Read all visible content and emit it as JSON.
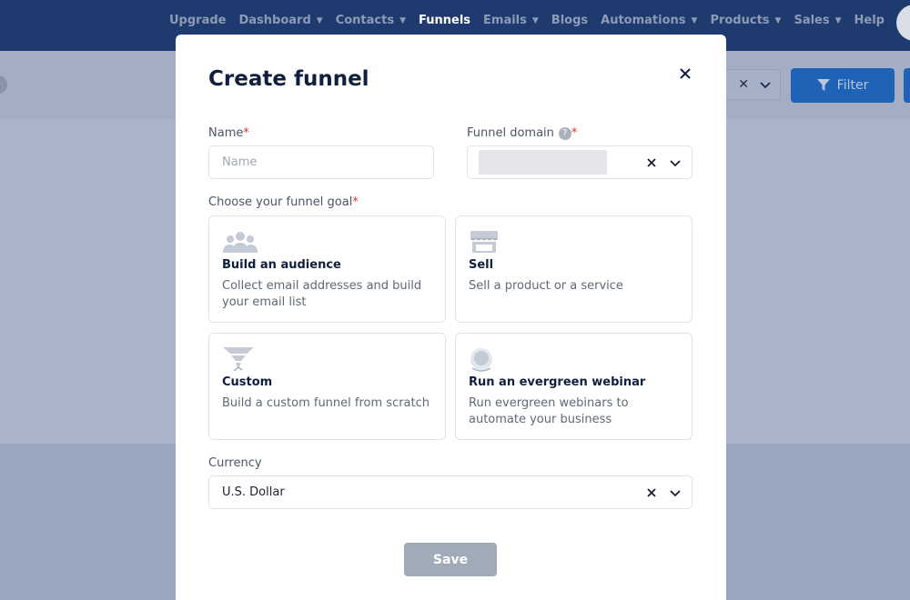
{
  "nav": {
    "items": [
      {
        "label": "Upgrade",
        "dropdown": false,
        "active": false
      },
      {
        "label": "Dashboard",
        "dropdown": true,
        "active": false
      },
      {
        "label": "Contacts",
        "dropdown": true,
        "active": false
      },
      {
        "label": "Funnels",
        "dropdown": false,
        "active": true
      },
      {
        "label": "Emails",
        "dropdown": true,
        "active": false
      },
      {
        "label": "Blogs",
        "dropdown": false,
        "active": false
      },
      {
        "label": "Automations",
        "dropdown": true,
        "active": false
      },
      {
        "label": "Products",
        "dropdown": true,
        "active": false
      },
      {
        "label": "Sales",
        "dropdown": true,
        "active": false
      },
      {
        "label": "Help",
        "dropdown": false,
        "active": false
      }
    ]
  },
  "toolbar": {
    "filter_label": "Filter"
  },
  "modal": {
    "title": "Create funnel",
    "name_label": "Name",
    "name_placeholder": "Name",
    "domain_label": "Funnel domain",
    "domain_help": "?",
    "goal_label": "Choose your funnel goal",
    "required_mark": "*",
    "goals": [
      {
        "icon": "audience-icon",
        "title": "Build an audience",
        "description": "Collect email addresses and build your email list"
      },
      {
        "icon": "store-icon",
        "title": "Sell",
        "description": "Sell a product or a service"
      },
      {
        "icon": "funnel-icon",
        "title": "Custom",
        "description": "Build a custom funnel from scratch"
      },
      {
        "icon": "webinar-icon",
        "title": "Run an evergreen webinar",
        "description": "Run evergreen webinars to automate your business"
      }
    ],
    "currency_label": "Currency",
    "currency_value": "U.S. Dollar",
    "save_label": "Save"
  },
  "colors": {
    "nav_bg": "#1e3a6e",
    "primary": "#1f63b6",
    "overlay": "#a9b3ca",
    "required": "#e03131",
    "save_disabled": "#a1abb7"
  }
}
